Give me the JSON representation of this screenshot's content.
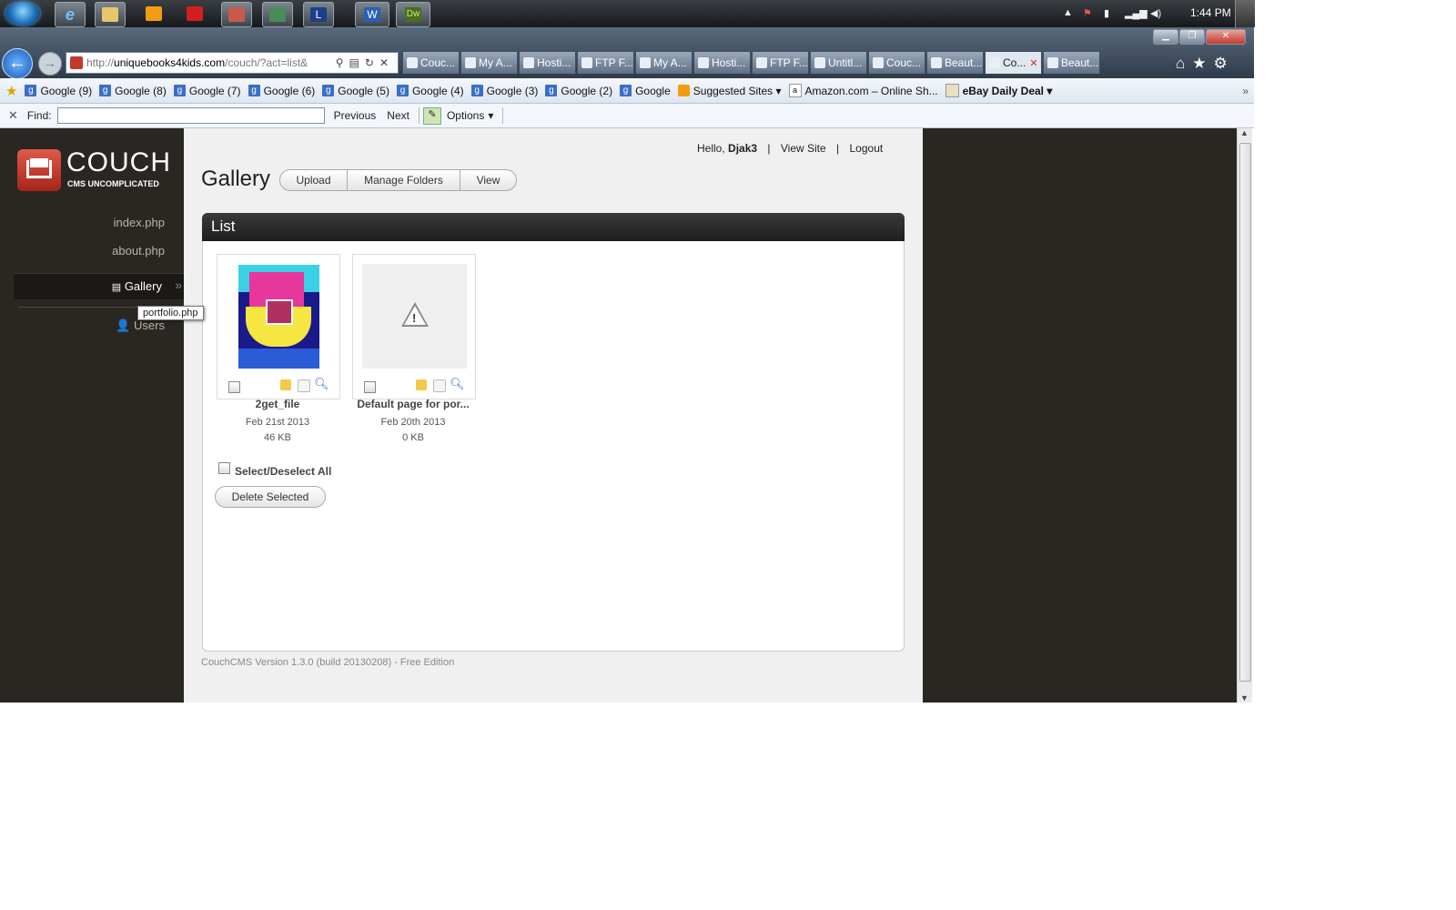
{
  "taskbar": {
    "clock": "1:44 PM",
    "buttons": [
      "ie-icon",
      "explorer-icon",
      "media-player-icon",
      "youtube-icon",
      "app-icon",
      "camera-icon",
      "app-l-icon",
      "word-icon",
      "dreamweaver-icon"
    ],
    "word_label": "W",
    "dw_label": "Dw",
    "l_label": "L"
  },
  "browser": {
    "address": {
      "prefix": "http://",
      "domain": "uniquebooks4kids.com",
      "path": "/couch/?act=list&"
    },
    "tabs": [
      {
        "label": "Couc...",
        "active": false
      },
      {
        "label": "My A...",
        "active": false
      },
      {
        "label": "Hosti...",
        "active": false
      },
      {
        "label": "FTP F...",
        "active": false
      },
      {
        "label": "My A...",
        "active": false
      },
      {
        "label": "Hosti...",
        "active": false
      },
      {
        "label": "FTP F...",
        "active": false
      },
      {
        "label": "Untitl...",
        "active": false
      },
      {
        "label": "Couc...",
        "active": false
      },
      {
        "label": "Beaut...",
        "active": false
      },
      {
        "label": "Co...",
        "active": true
      },
      {
        "label": "Beaut...",
        "active": false
      }
    ],
    "favorites": [
      "Google (9)",
      "Google (8)",
      "Google (7)",
      "Google (6)",
      "Google (5)",
      "Google (4)",
      "Google (3)",
      "Google (2)",
      "Google"
    ],
    "suggested_sites": "Suggested Sites",
    "amazon": "Amazon.com – Online Sh...",
    "ebay": "eBay Daily Deal",
    "find": {
      "label": "Find:",
      "value": "",
      "previous": "Previous",
      "next": "Next",
      "options": "Options"
    }
  },
  "cms": {
    "logo": {
      "name": "COUCH",
      "tagline": "CMS UNCOMPLICATED"
    },
    "nav": [
      {
        "label": "index.php"
      },
      {
        "label": "about.php"
      },
      {
        "label": "Gallery"
      },
      {
        "label": "Users"
      }
    ],
    "tooltip": "portfolio.php",
    "header": {
      "hello": "Hello,",
      "user": "Djak3",
      "view_site": "View Site",
      "logout": "Logout",
      "sep": "|"
    },
    "page_title": "Gallery",
    "actions": [
      "Upload",
      "Manage Folders",
      "View"
    ],
    "list_title": "List",
    "items": [
      {
        "name": "2get_file",
        "date": "Feb 21st 2013",
        "size": "46 KB"
      },
      {
        "name": "Default page for por...",
        "date": "Feb 20th 2013",
        "size": "0 KB"
      }
    ],
    "select_all": "Select/Deselect All",
    "delete_selected": "Delete Selected",
    "footer": "CouchCMS Version 1.3.0 (build 20130208) - Free Edition"
  },
  "colors": {
    "sidebar_bg": "#2a2723",
    "main_bg": "#f0f0f0",
    "logo_red": "#c0392b"
  }
}
